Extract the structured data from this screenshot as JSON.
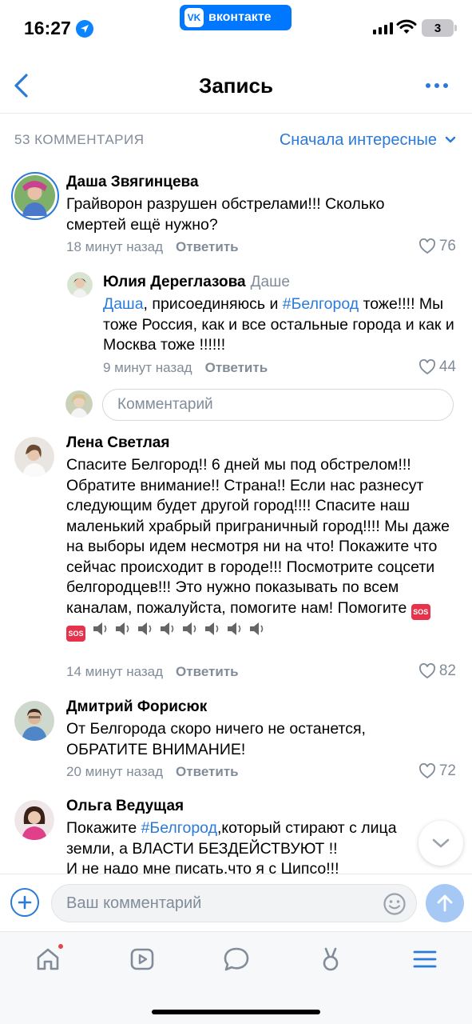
{
  "status_bar": {
    "time": "16:27",
    "app_label": "вконтакте",
    "app_logo": "VK",
    "battery": "3"
  },
  "header": {
    "title": "Запись",
    "back_icon": "chevron-left-icon",
    "more_icon": "more-horizontal-icon"
  },
  "comments_header": {
    "count_label": "53 КОММЕНТАРИЯ",
    "sort_label": "Сначала интересные"
  },
  "comments": [
    {
      "author": "Даша Звягинцева",
      "text": "Грайворон разрушен обстрелами!!! Сколько смертей ещё  нужно?",
      "time": "18 минут назад",
      "reply_label": "Ответить",
      "likes": "76"
    },
    {
      "author": "Юлия Дереглазова",
      "reply_to": "Даше",
      "text_mention": "Даша",
      "text_mid": ", присоединяюсь и ",
      "text_hashtag": "#Белгород",
      "text_rest": " тоже!!!! Мы тоже Россия, как и все остальные города и как и Москва тоже !!!!!!",
      "time": "9 минут назад",
      "reply_label": "Ответить",
      "likes": "44"
    },
    {
      "author": "Лена Светлая",
      "text": "Спасите Белгород!! 6 дней мы под обстрелом!!! Обратите внимание!! Страна!! Если нас разнесут следующим будет другой город!!!! Спасите наш маленький храбрый приграничный город!!!! Мы даже на выборы идем несмотря ни на что! Покажите что сейчас происходит в городе!!! Посмотрите соцсети белгородцев!!! Это нужно показывать по всем каналам, пожалуйста, помогите нам! Помогите",
      "emoji_sos": "SOS",
      "time": "14 минут назад",
      "reply_label": "Ответить",
      "likes": "82"
    },
    {
      "author": "Дмитрий Форисюк",
      "text": "От Белгорода скоро ничего не останется, ОБРАТИТЕ ВНИМАНИЕ!",
      "time": "20 минут назад",
      "reply_label": "Ответить",
      "likes": "72"
    },
    {
      "author": "Ольга Ведущая",
      "text_start": "Покажите ",
      "text_hashtag": "#Белгород",
      "text_rest": ",который стирают с лица земли, а ВЛАСТИ БЕЗДЕЙСТВУЮТ !!",
      "text_line3": "И не надо мне писать,что я с Ципсо!!!"
    }
  ],
  "reply_input": {
    "placeholder": "Комментарий"
  },
  "composer": {
    "placeholder": "Ваш комментарий"
  },
  "tabbar": {
    "items": [
      "home-icon",
      "video-icon",
      "messages-icon",
      "clips-icon",
      "menu-icon"
    ]
  },
  "colors": {
    "accent": "#2a7ad9",
    "vk_blue": "#0077ff",
    "meta_gray": "#818c99",
    "badge_red": "#e64646"
  }
}
